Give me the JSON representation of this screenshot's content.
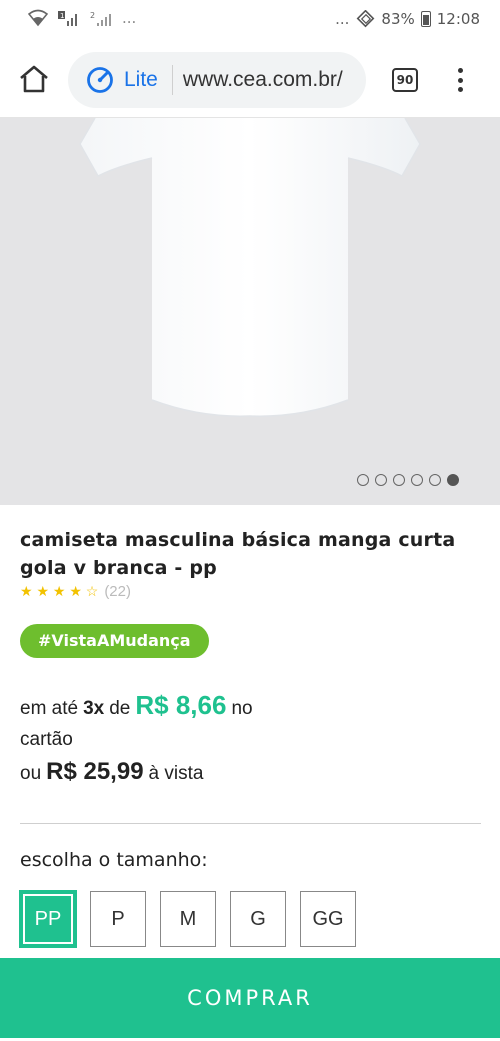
{
  "status_bar": {
    "left_icons": [
      "wifi-icon",
      "signal-icon",
      "signal-icon"
    ],
    "sim1": "1",
    "sim2": "2",
    "more": "...",
    "battery": "83%",
    "time": "12:08"
  },
  "browser": {
    "lite_label": "Lite",
    "url": "www.cea.com.br/",
    "tab_count": "90",
    "icons": [
      "home-icon",
      "lite-gauge-icon",
      "tabs-icon",
      "overflow-menu-icon"
    ]
  },
  "gallery": {
    "image_count": 6,
    "active_index": 5
  },
  "product": {
    "title": "camiseta masculina básica manga curta gola v branca - pp",
    "rating_value": 4.5,
    "rating_stars": "★ ★ ★ ★ ☆",
    "rating_count": "(22)",
    "tag": "#VistaAMudança",
    "price_prefix": "em até",
    "installments": "3x",
    "installment_of": "de",
    "installment_value": "R$ 8,66",
    "installment_suffix": "no",
    "installment_suffix2": "cartão",
    "cash_prefix": "ou",
    "cash_value": "R$ 25,99",
    "cash_suffix": "à vista"
  },
  "size_selector": {
    "label": "escolha o tamanho:",
    "options": [
      "PP",
      "P",
      "M",
      "G",
      "GG"
    ],
    "selected": "PP"
  },
  "buy_button": {
    "label": "COMPRAR"
  },
  "colors": {
    "accent": "#1fc18f",
    "tag_green": "#6ebe2e",
    "star": "#f2c200",
    "link_blue": "#1a73e8"
  }
}
